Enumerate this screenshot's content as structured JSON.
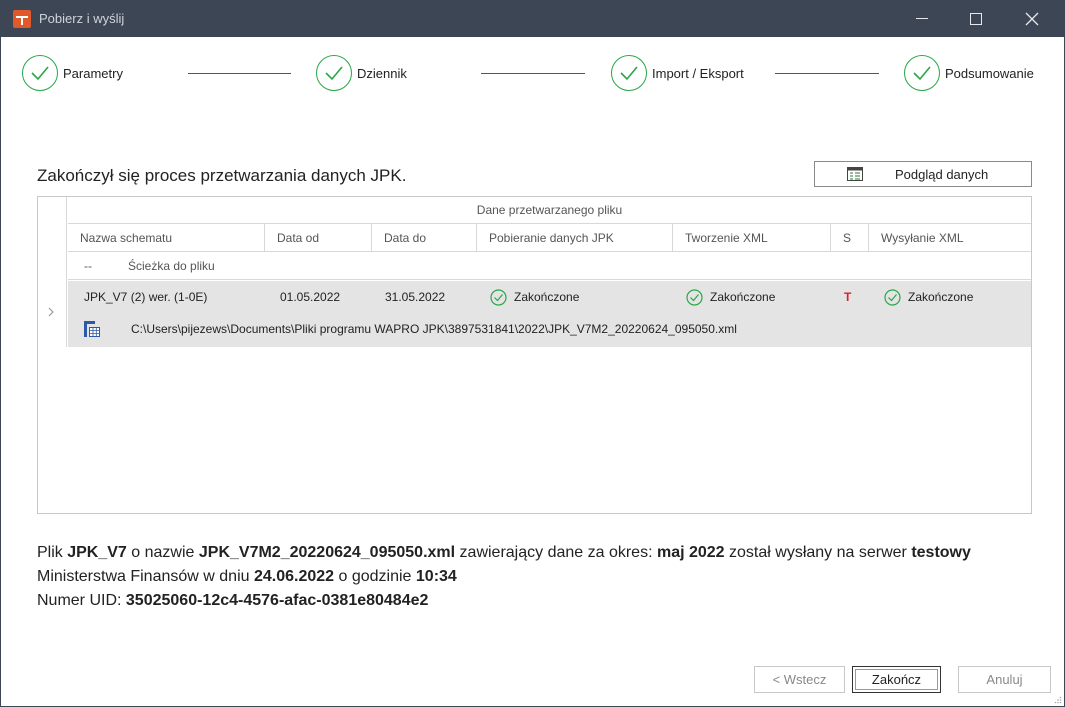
{
  "window": {
    "title": "Pobierz i wyślij",
    "brand_color": "#e0592a",
    "titlebar_color": "#3c4654"
  },
  "steps": [
    {
      "label": "Parametry",
      "icon": "check-circle-icon"
    },
    {
      "label": "Dziennik",
      "icon": "check-circle-icon"
    },
    {
      "label": "Import / Eksport",
      "icon": "check-circle-icon"
    },
    {
      "label": "Podsumowanie",
      "icon": "check-circle-icon"
    }
  ],
  "headline": "Zakończył się proces przetwarzania danych JPK.",
  "preview_button": {
    "label": "Podgląd danych",
    "icon": "table-icon"
  },
  "grid": {
    "band_header": "Dane przetwarzanego pliku",
    "columns": [
      "Nazwa schematu",
      "Data od",
      "Data do",
      "Pobieranie danych JPK",
      "Tworzenie XML",
      "S",
      "Wysyłanie XML"
    ],
    "sub_header": {
      "dash": "--",
      "path": "Ścieżka do pliku"
    },
    "row": {
      "schema": "JPK_V7 (2) wer. (1-0E)",
      "date_from": "01.05.2022",
      "date_to": "31.05.2022",
      "download_status": "Zakończone",
      "xml_status": "Zakończone",
      "s_flag": "T",
      "send_status": "Zakończone",
      "path": "C:\\Users\\pijezews\\Documents\\Pliki programu WAPRO JPK\\3897531841\\2022\\JPK_V7M2_20220624_095050.xml"
    },
    "status_color": "#28a745",
    "flag_color": "#d4242a"
  },
  "summary": {
    "p1": "Plik ",
    "file_type": "JPK_V7",
    "p2": " o nazwie ",
    "file_name": "JPK_V7M2_20220624_095050.xml",
    "p3": " zawierający dane za okres: ",
    "period": "maj 2022",
    "p4": " został wysłany na serwer ",
    "server": "testowy",
    "p5": " Ministerstwa Finansów w dniu ",
    "date": "24.06.2022",
    "p6": " o godzinie ",
    "time": "10:34",
    "uid_label": "Numer UID: ",
    "uid": "35025060-12c4-4576-afac-0381e80484e2"
  },
  "buttons": {
    "back": "< Wstecz",
    "finish": "Zakończ",
    "cancel": "Anuluj"
  }
}
